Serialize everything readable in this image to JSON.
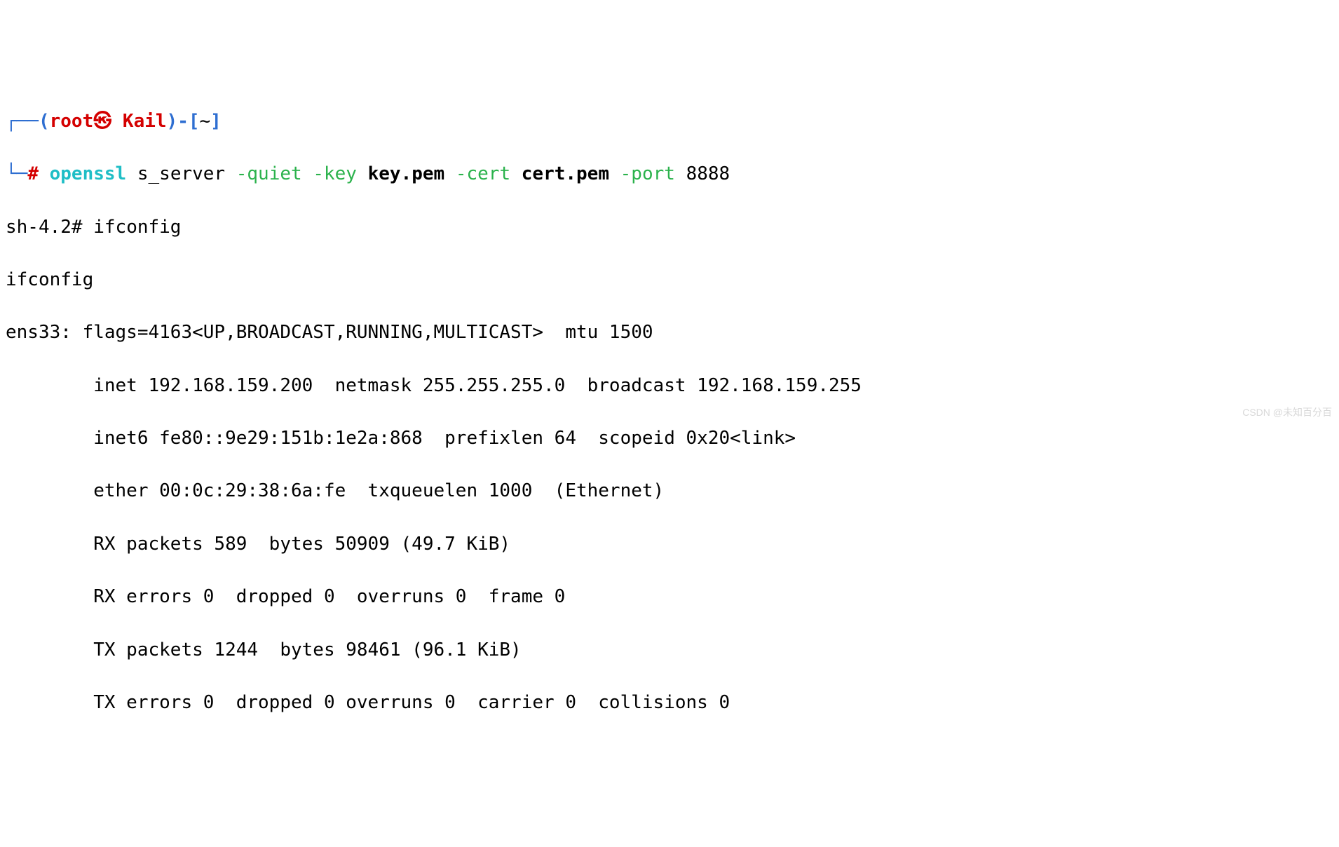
{
  "prompt": {
    "box_top": "┌──(",
    "user": "root",
    "at": "㉿",
    "host": " Kail",
    "paren_close": ")",
    "dash": "-[",
    "cwd": "~",
    "bracket_close": "]",
    "box_bottom": "└─",
    "hash": "# ",
    "cmd": "openssl",
    "sub": " s_server ",
    "flag_quiet": "-quiet ",
    "flag_key": "-key ",
    "key_file": "key.pem ",
    "flag_cert": "-cert ",
    "cert_file": "cert.pem ",
    "flag_port": "-port ",
    "port": "8888"
  },
  "shell": {
    "prompt": "sh-4.2# ",
    "cmd": "ifconfig",
    "echo": "ifconfig"
  },
  "ifconfig": {
    "iface_line": "ens33: flags=4163<UP,BROADCAST,RUNNING,MULTICAST>  mtu 1500",
    "inet": "        inet 192.168.159.200  netmask 255.255.255.0  broadcast 192.168.159.255",
    "inet6": "        inet6 fe80::9e29:151b:1e2a:868  prefixlen 64  scopeid 0x20<link>",
    "ether": "        ether 00:0c:29:38:6a:fe  txqueuelen 1000  (Ethernet)",
    "rxp": "        RX packets 589  bytes 50909 (49.7 KiB)",
    "rxe": "        RX errors 0  dropped 0  overruns 0  frame 0",
    "txp": "        TX packets 1244  bytes 98461 (96.1 KiB)",
    "txe": "        TX errors 0  dropped 0 overruns 0  carrier 0  collisions 0"
  },
  "watermark": "CSDN @未知百分百"
}
